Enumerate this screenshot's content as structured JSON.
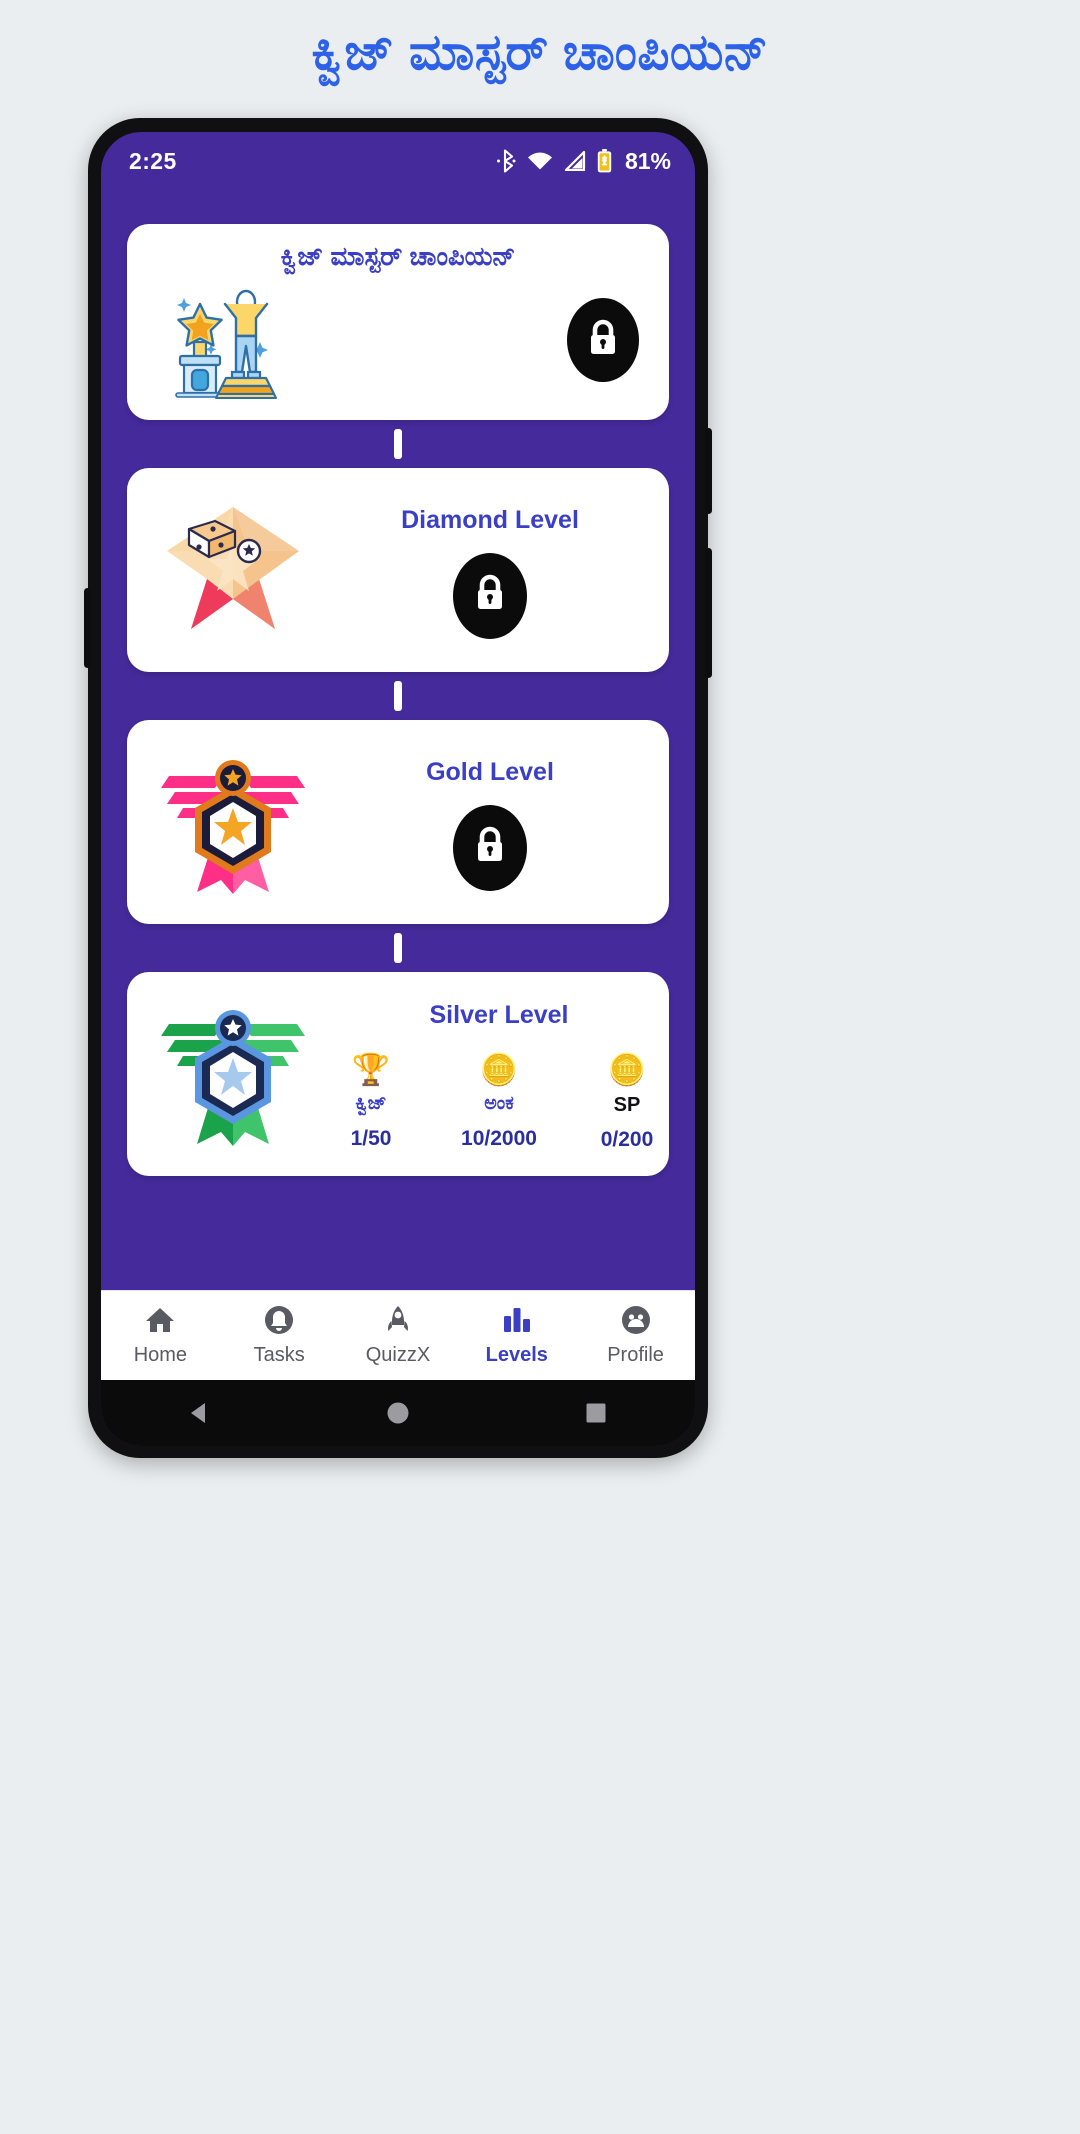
{
  "page": {
    "heading": "ಕ್ವಿಜ್ ಮಾಸ್ಟರ್ ಚಾಂಪಿಯನ್",
    "heading_color": "#2d62e8",
    "background": "#eaeef0"
  },
  "phone": {
    "screen_background": "#452a9b",
    "frame_color": "#101012"
  },
  "status_bar": {
    "time": "2:25",
    "battery_percent": "81%",
    "icons": [
      "bluetooth-icon",
      "wifi-icon",
      "cellular-signal-icon",
      "battery-icon"
    ]
  },
  "levels": [
    {
      "title": "ಕ್ವಿಜ್ ಮಾಸ್ಟರ್ ಚಾಂಪಿಯನ್",
      "art": "trophy-podium-illustration",
      "state": "locked",
      "lock_icon": "lock-icon"
    },
    {
      "title": "Diamond Level",
      "art": "diamond-star-badge-illustration",
      "state": "locked",
      "lock_icon": "lock-icon"
    },
    {
      "title": "Gold Level",
      "art": "gold-medal-badge-illustration",
      "state": "locked",
      "lock_icon": "lock-icon"
    },
    {
      "title": "Silver Level",
      "art": "silver-medal-badge-illustration",
      "state": "current",
      "stats": [
        {
          "icon": "trophy-emoji",
          "glyph": "🏆",
          "label": "ಕ್ವಿಜ್",
          "value": "1/50",
          "label_color": "#3a3fc4"
        },
        {
          "icon": "coins-emoji",
          "glyph": "🪙",
          "label": "ಅಂಕ",
          "value": "10/2000",
          "label_color": "#3a3fc4"
        },
        {
          "icon": "coin-emoji",
          "glyph": "🪙",
          "label": "SP",
          "value": "0/200",
          "label_color": "#111114"
        }
      ]
    }
  ],
  "bottom_nav": {
    "items": [
      {
        "label": "Home",
        "icon": "home-icon",
        "active": false
      },
      {
        "label": "Tasks",
        "icon": "bell-icon",
        "active": false
      },
      {
        "label": "QuizzX",
        "icon": "rocket-icon",
        "active": false
      },
      {
        "label": "Levels",
        "icon": "bar-chart-icon",
        "active": true
      },
      {
        "label": "Profile",
        "icon": "person-icon",
        "active": false
      }
    ],
    "active_color": "#3a3fc4",
    "inactive_color": "#5a5a62"
  },
  "system_nav": {
    "items": [
      "back-triangle-icon",
      "home-circle-icon",
      "recents-square-icon"
    ]
  }
}
